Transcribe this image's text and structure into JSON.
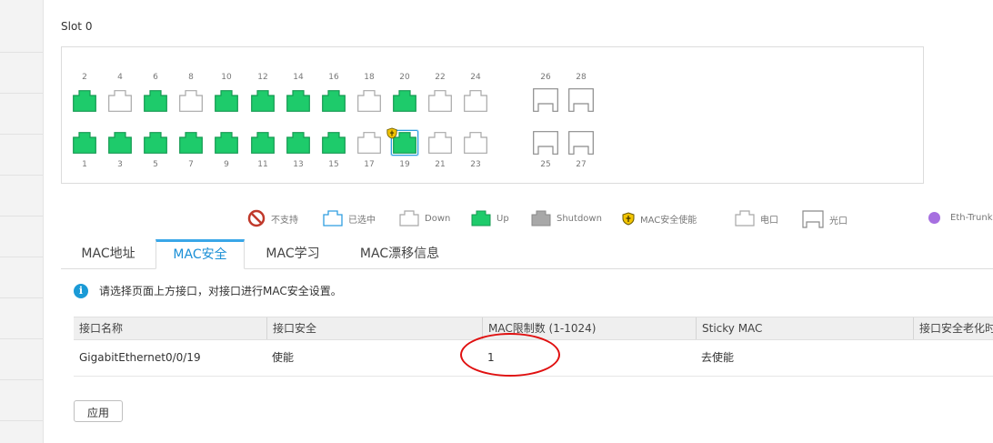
{
  "slot_title": "Slot 0",
  "ports_top": [
    {
      "label": "2",
      "state": "up"
    },
    {
      "label": "4",
      "state": "down"
    },
    {
      "label": "6",
      "state": "up"
    },
    {
      "label": "8",
      "state": "down"
    },
    {
      "label": "10",
      "state": "up"
    },
    {
      "label": "12",
      "state": "up"
    },
    {
      "label": "14",
      "state": "up"
    },
    {
      "label": "16",
      "state": "up"
    },
    {
      "label": "18",
      "state": "down"
    },
    {
      "label": "20",
      "state": "up"
    },
    {
      "label": "22",
      "state": "down"
    },
    {
      "label": "24",
      "state": "down"
    }
  ],
  "ports_bottom": [
    {
      "label": "1",
      "state": "up"
    },
    {
      "label": "3",
      "state": "up"
    },
    {
      "label": "5",
      "state": "up"
    },
    {
      "label": "7",
      "state": "up"
    },
    {
      "label": "9",
      "state": "up"
    },
    {
      "label": "11",
      "state": "up"
    },
    {
      "label": "13",
      "state": "up"
    },
    {
      "label": "15",
      "state": "up"
    },
    {
      "label": "17",
      "state": "down"
    },
    {
      "label": "19",
      "state": "up-selected-secure"
    },
    {
      "label": "21",
      "state": "down"
    },
    {
      "label": "23",
      "state": "down"
    }
  ],
  "optical_top": [
    {
      "label": "26"
    },
    {
      "label": "28"
    }
  ],
  "optical_bottom": [
    {
      "label": "25"
    },
    {
      "label": "27"
    }
  ],
  "legend": {
    "unsupported": "不支持",
    "selected": "已选中",
    "down": "Down",
    "up": "Up",
    "shutdown": "Shutdown",
    "mac_secure": "MAC安全使能",
    "electrical": "电口",
    "optical": "光口",
    "eth_trunk": "Eth-Trunk"
  },
  "colors": {
    "up": "#1ecb6b",
    "selected_border": "#2f9ee0",
    "shutdown": "#a8a8a8",
    "eth_trunk": "#a66fe0",
    "accent": "#1a8fd6",
    "annotation": "#e01010"
  },
  "tabs": [
    {
      "label": "MAC地址",
      "active": false
    },
    {
      "label": "MAC安全",
      "active": true
    },
    {
      "label": "MAC学习",
      "active": false
    },
    {
      "label": "MAC漂移信息",
      "active": false
    }
  ],
  "info_text": "请选择页面上方接口，对接口进行MAC安全设置。",
  "table": {
    "headers": [
      "接口名称",
      "接口安全",
      "MAC限制数 (1-1024)",
      "Sticky MAC",
      "接口安全老化时"
    ],
    "rows": [
      [
        "GigabitEthernet0/0/19",
        "使能",
        "1",
        "去使能",
        ""
      ]
    ]
  },
  "apply_label": "应用"
}
